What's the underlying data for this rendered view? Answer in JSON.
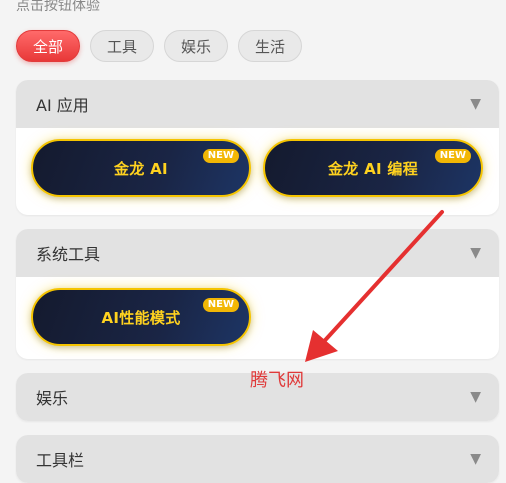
{
  "hint": "点击按钮体验",
  "filters": [
    {
      "label": "全部",
      "active": true
    },
    {
      "label": "工具"
    },
    {
      "label": "娱乐"
    },
    {
      "label": "生活"
    }
  ],
  "sections": [
    {
      "title": "AI 应用",
      "caret": "▼",
      "buttons": [
        {
          "label": "金龙 AI",
          "badge": "NEW"
        },
        {
          "label": "金龙 AI 编程",
          "badge": "NEW"
        }
      ]
    },
    {
      "title": "系统工具",
      "caret": "▼",
      "buttons": [
        {
          "label": "AI性能模式",
          "badge": "NEW"
        }
      ]
    },
    {
      "title": "娱乐",
      "caret": "▼"
    },
    {
      "title": "工具栏",
      "caret": "▼"
    }
  ],
  "watermark": "腾飞网",
  "colors": {
    "accent_red": "#e83838",
    "button_gold": "#f5c400",
    "button_navy": "#1a2545",
    "section_header": "#e2e2e2",
    "arrow_red": "#e53030"
  },
  "icons": {
    "caret": "caret-down-icon",
    "annotation": "red-arrow-annotation"
  }
}
